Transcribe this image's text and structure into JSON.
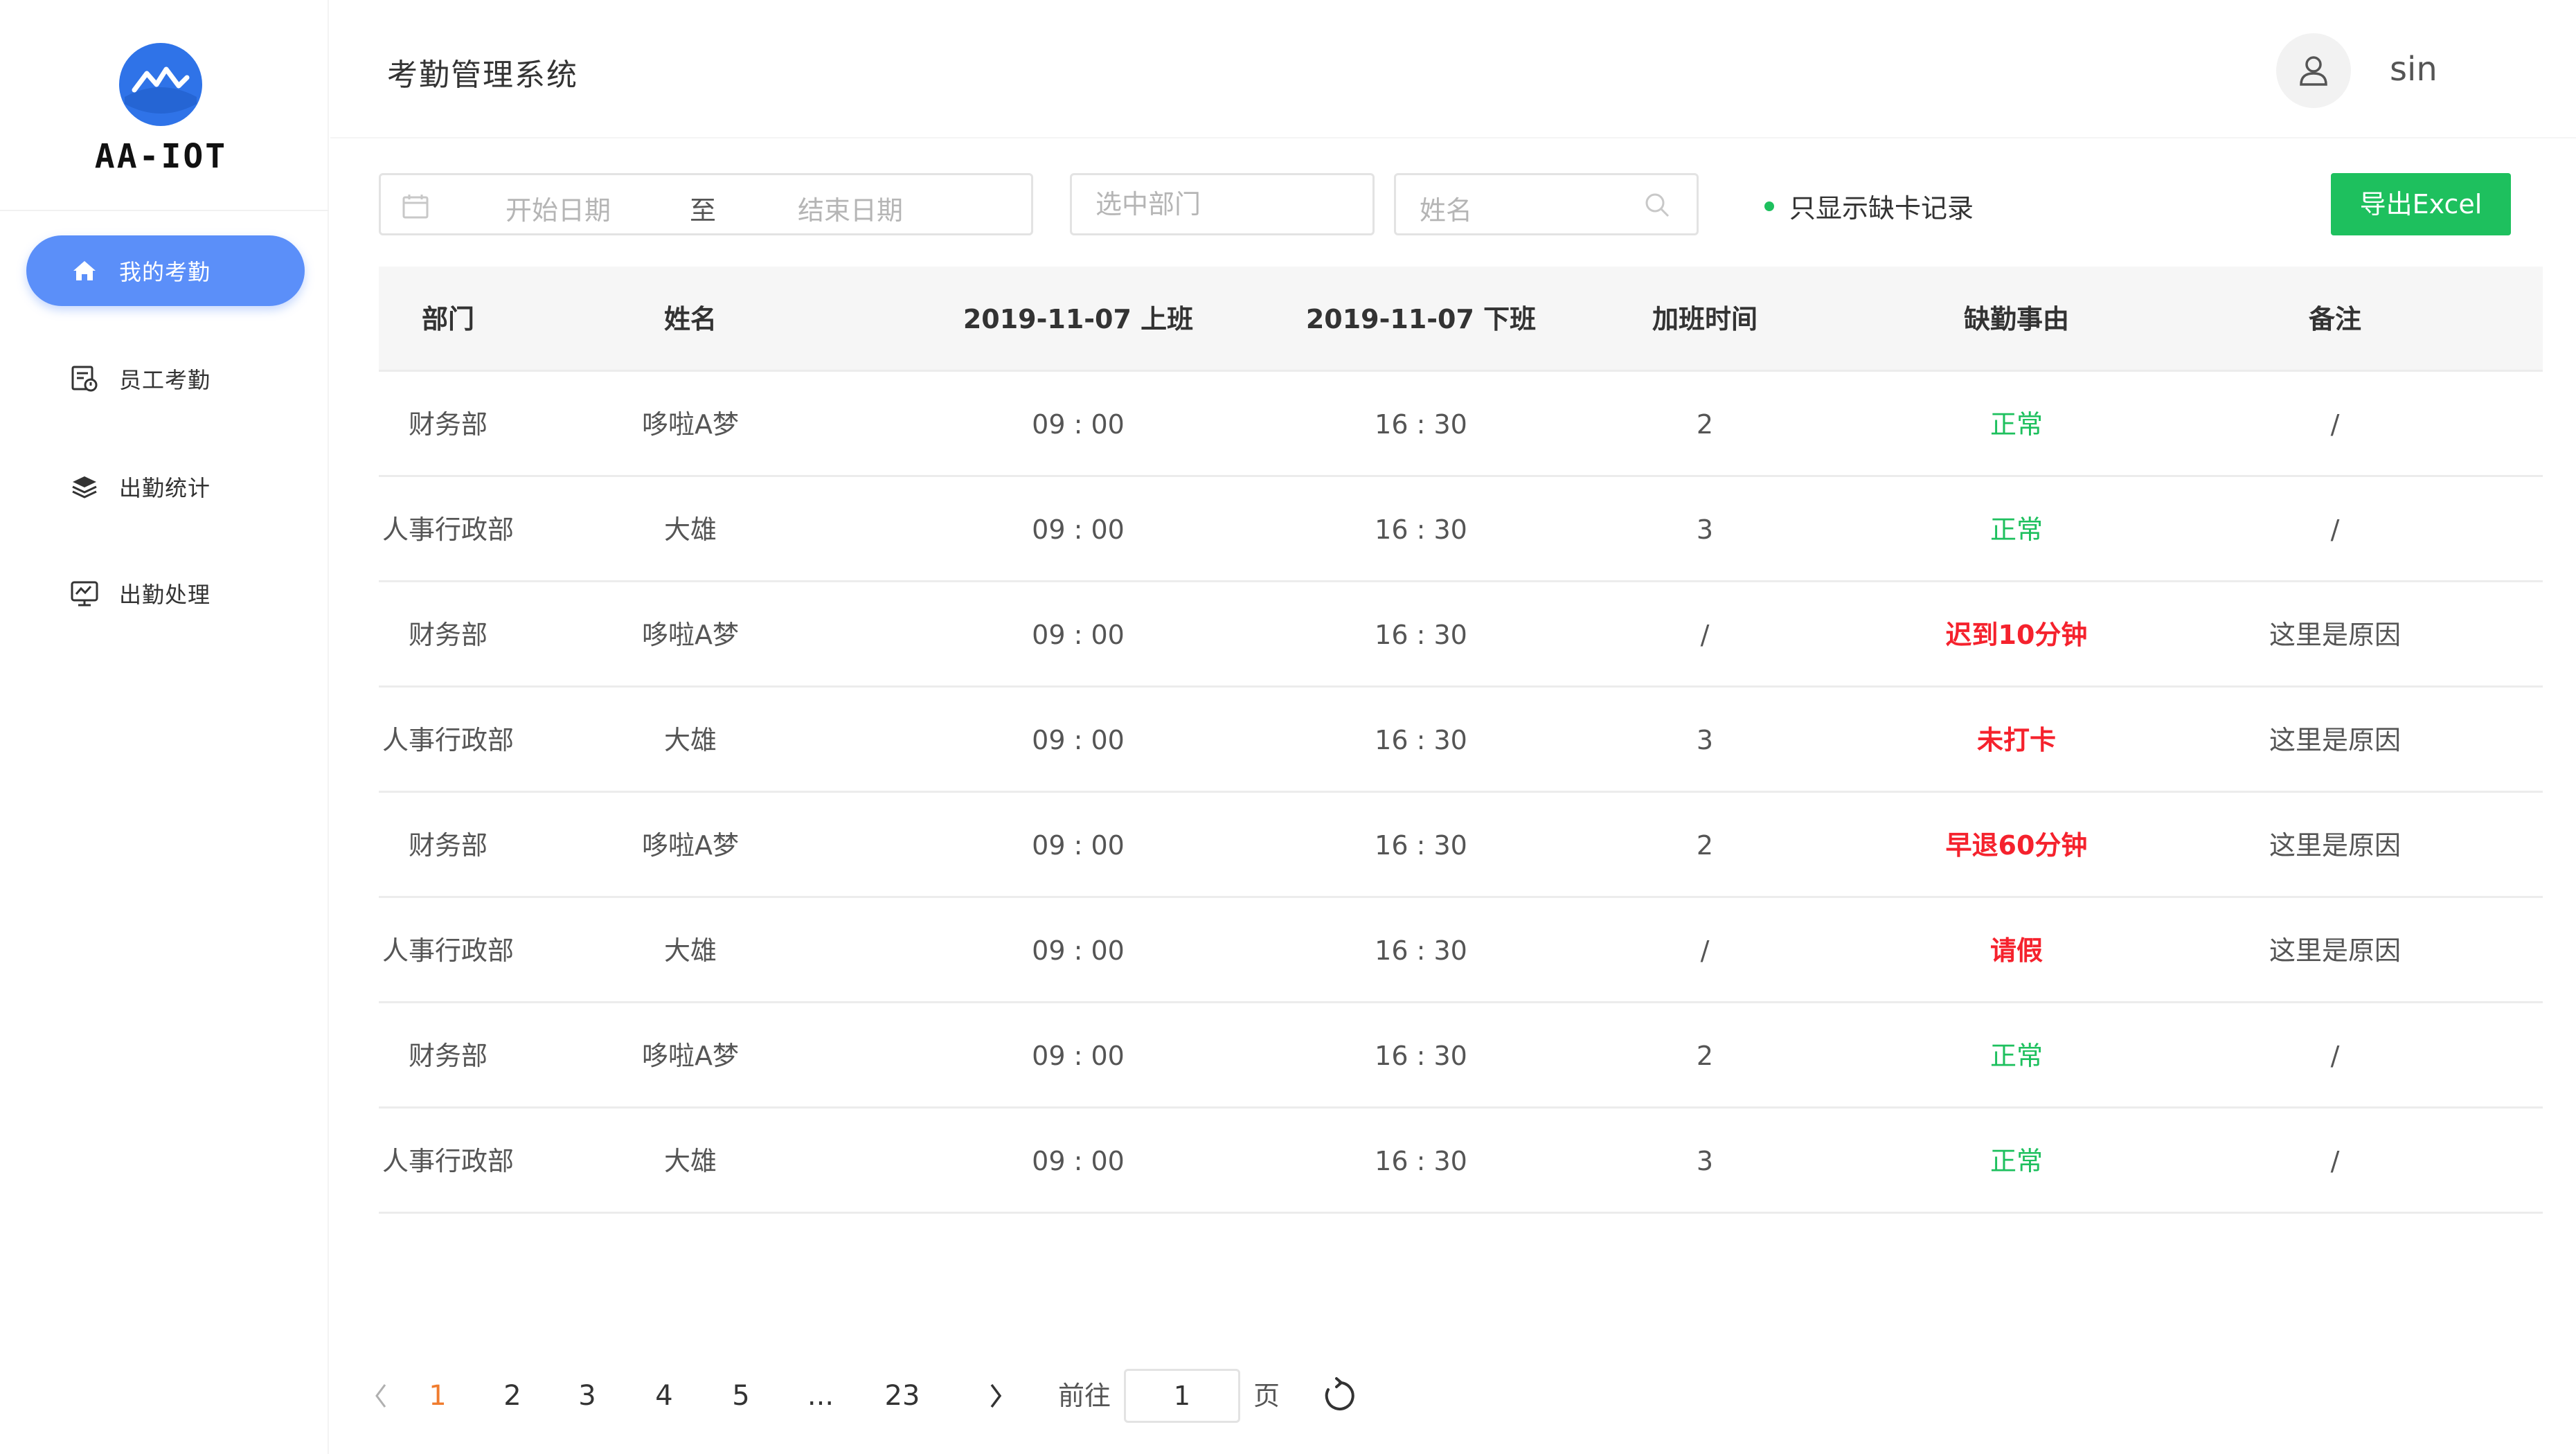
{
  "brand": {
    "name": "AA-IOT",
    "accent": "#2f73e8"
  },
  "app": {
    "title": "考勤管理系统"
  },
  "user": {
    "name": "sin"
  },
  "sidebar": {
    "items": [
      {
        "label": "我的考勤",
        "icon": "home-icon",
        "active": true
      },
      {
        "label": "员工考勤",
        "icon": "employee-attendance-icon",
        "active": false
      },
      {
        "label": "出勤统计",
        "icon": "layers-icon",
        "active": false
      },
      {
        "label": "出勤处理",
        "icon": "monitor-icon",
        "active": false
      }
    ]
  },
  "filters": {
    "start_placeholder": "开始日期",
    "range_separator": "至",
    "end_placeholder": "结束日期",
    "dept_placeholder": "选中部门",
    "name_placeholder": "姓名",
    "only_missing_label": "只显示缺卡记录",
    "export_label": "导出Excel"
  },
  "table": {
    "headers": [
      "部门",
      "姓名",
      "2019-11-07  上班",
      "2019-11-07  下班",
      "加班时间",
      "缺勤事由",
      "备注"
    ],
    "rows": [
      {
        "dept": "财务部",
        "name": "哆啦A梦",
        "in": "09 : 00",
        "out": "16 : 30",
        "ot": "2",
        "reason": "正常",
        "status": "ok",
        "note": "/"
      },
      {
        "dept": "人事行政部",
        "name": "大雄",
        "in": "09 : 00",
        "out": "16 : 30",
        "ot": "3",
        "reason": "正常",
        "status": "ok",
        "note": "/"
      },
      {
        "dept": "财务部",
        "name": "哆啦A梦",
        "in": "09 : 00",
        "out": "16 : 30",
        "ot": "/",
        "reason": "迟到10分钟",
        "status": "bad",
        "note": "这里是原因"
      },
      {
        "dept": "人事行政部",
        "name": "大雄",
        "in": "09 : 00",
        "out": "16 : 30",
        "ot": "3",
        "reason": "未打卡",
        "status": "bad",
        "note": "这里是原因"
      },
      {
        "dept": "财务部",
        "name": "哆啦A梦",
        "in": "09 : 00",
        "out": "16 : 30",
        "ot": "2",
        "reason": "早退60分钟",
        "status": "bad",
        "note": "这里是原因"
      },
      {
        "dept": "人事行政部",
        "name": "大雄",
        "in": "09 : 00",
        "out": "16 : 30",
        "ot": "/",
        "reason": "请假",
        "status": "bad",
        "note": "这里是原因"
      },
      {
        "dept": "财务部",
        "name": "哆啦A梦",
        "in": "09 : 00",
        "out": "16 : 30",
        "ot": "2",
        "reason": "正常",
        "status": "ok",
        "note": "/"
      },
      {
        "dept": "人事行政部",
        "name": "大雄",
        "in": "09 : 00",
        "out": "16 : 30",
        "ot": "3",
        "reason": "正常",
        "status": "ok",
        "note": "/"
      }
    ]
  },
  "pagination": {
    "prev": "<",
    "pages": [
      "1",
      "2",
      "3",
      "4",
      "5",
      "...",
      "23"
    ],
    "current": "1",
    "next": ">",
    "goto_label": "前往",
    "goto_value": "1",
    "page_suffix": "页"
  },
  "colors": {
    "ok": "#1ec05e",
    "bad": "#f5222d",
    "nav_active": "#5b8ff9",
    "page_active": "#f07c2e"
  }
}
